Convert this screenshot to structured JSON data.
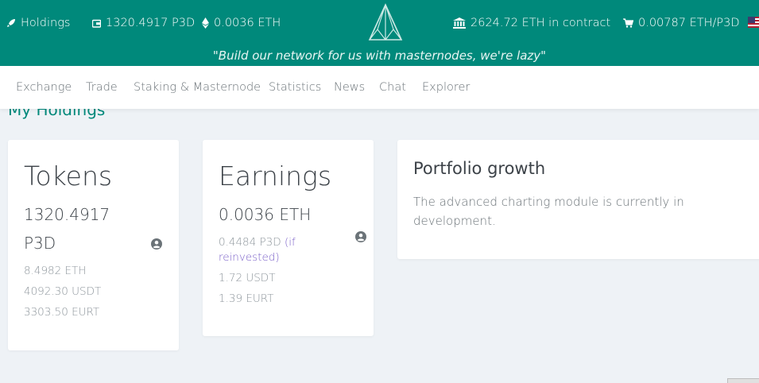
{
  "topbar": {
    "holdings_label": "Holdings",
    "p3d_balance": "1320.4917 P3D",
    "eth_balance": "0.0036 ETH",
    "contract_eth": "2624.72 ETH in contract",
    "price": "0.00787 ETH/P3D",
    "slogan": "\"Build our network for us with masternodes, we're lazy\""
  },
  "nav": {
    "items": [
      "Exchange",
      "Trade",
      "Staking & Masternode",
      "Statistics",
      "News",
      "Chat",
      "Explorer"
    ]
  },
  "page": {
    "title": "My Holdings"
  },
  "tokens_card": {
    "title": "Tokens",
    "value_line1": "1320.4917",
    "value_line2": "P3D",
    "eth": "8.4982 ETH",
    "usdt": "4092.30 USDT",
    "eurt": "3303.50 EURT"
  },
  "earnings_card": {
    "title": "Earnings",
    "value": "0.0036 ETH",
    "reinvest_amount": "0.4484 P3D",
    "reinvest_note_1": "(if",
    "reinvest_note_2": "reinvested)",
    "usdt": "1.72 USDT",
    "eurt": "1.39 EURT"
  },
  "portfolio_card": {
    "title": "Portfolio growth",
    "text": "The advanced charting module is currently in development."
  },
  "icons": {
    "holdings": "rocket-icon",
    "wallet": "wallet-icon",
    "eth": "ethereum-icon",
    "contract": "bank-icon",
    "price": "cart-icon",
    "flag": "us-flag-icon",
    "user": "user-circle-icon"
  },
  "colors": {
    "brand": "#00897b",
    "accent": "#7b61c9",
    "background": "#eef2f6"
  }
}
